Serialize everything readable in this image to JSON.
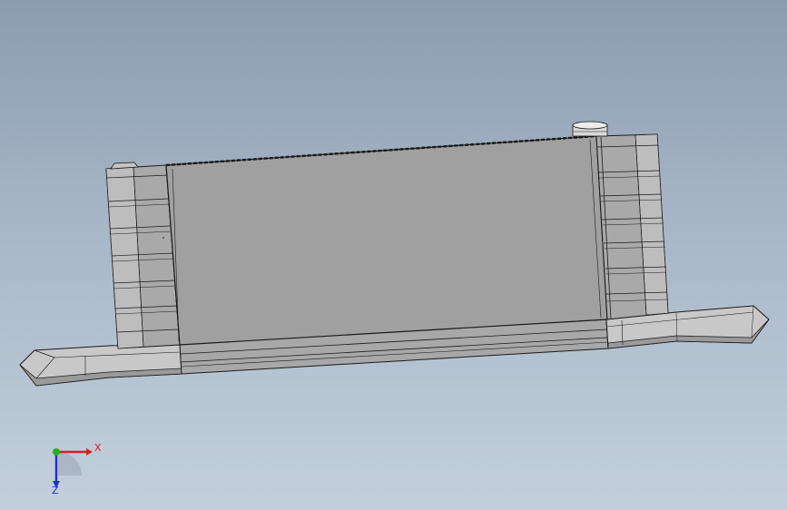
{
  "viewport": {
    "background_top": "#8a9cb0",
    "background_bottom": "#c3cfdc"
  },
  "model": {
    "body_color": "#a0a0a0",
    "edge_color": "#1a1a1a",
    "shade_color": "#b4b4b4",
    "light_color": "#d4d4d4"
  },
  "triad": {
    "x_label": "X",
    "z_label": "Z",
    "x_color": "#d42020",
    "y_color": "#20b020",
    "z_color": "#2030c8"
  }
}
